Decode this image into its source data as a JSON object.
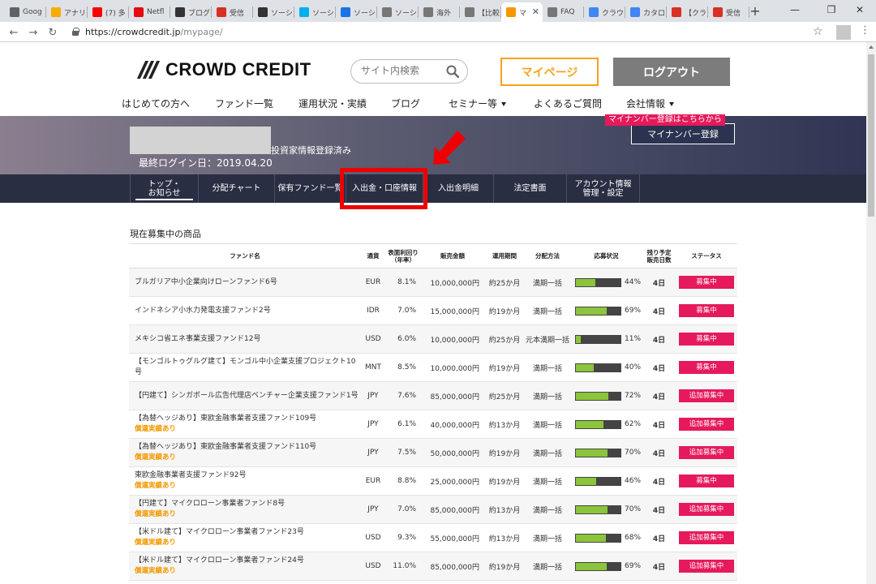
{
  "browser": {
    "tabs": [
      {
        "title": "Goog",
        "icon": "help-circle-icon",
        "color": "#5f6368"
      },
      {
        "title": "アナリ",
        "icon": "analytics-icon",
        "color": "#f9ab00"
      },
      {
        "title": "(7) 多",
        "icon": "youtube-icon",
        "color": "#ff0000"
      },
      {
        "title": "Netfl",
        "icon": "netflix-icon",
        "color": "#e50914"
      },
      {
        "title": "ブログ",
        "icon": "info-circle-icon",
        "color": "#333333"
      },
      {
        "title": "受信",
        "icon": "gmail-icon",
        "color": "#d93025"
      },
      {
        "title": "ソーシ",
        "icon": "wikipedia-icon",
        "color": "#333333"
      },
      {
        "title": "ソーシ",
        "icon": "skype-icon",
        "color": "#00aff0"
      },
      {
        "title": "ソーシ",
        "icon": "flag-icon",
        "color": "#1a73e8"
      },
      {
        "title": "ソーシ",
        "icon": "document-icon",
        "color": "#777777"
      },
      {
        "title": "海外",
        "icon": "document-icon",
        "color": "#777777"
      },
      {
        "title": "【比較",
        "icon": "document-icon",
        "color": "#777777"
      },
      {
        "title": "マ",
        "icon": "crowdcredit-icon",
        "color": "#f39800"
      },
      {
        "title": "FAQ",
        "icon": "document-icon",
        "color": "#777777"
      },
      {
        "title": "クラウ",
        "icon": "google-icon",
        "color": "#4285f4"
      },
      {
        "title": "カタロ",
        "icon": "google-icon",
        "color": "#4285f4"
      },
      {
        "title": "【クラ",
        "icon": "gmail-icon",
        "color": "#d93025"
      },
      {
        "title": "受信",
        "icon": "gmail-icon",
        "color": "#d93025"
      }
    ],
    "new_tab": "+",
    "minimize": "—",
    "maximize": "❐",
    "close": "✕",
    "url_host": "https://crowdcredit.jp",
    "url_path": "/mypage/",
    "back": "←",
    "forward": "→",
    "reload": "↻",
    "bookmark": "☆",
    "menu": "⋮"
  },
  "header": {
    "logo_text": "CROWD CREDIT",
    "search_placeholder": "サイト内検索",
    "mypage_label": "マイページ",
    "logout_label": "ログアウト",
    "nav": [
      {
        "label": "はじめての方へ",
        "dropdown": false
      },
      {
        "label": "ファンド一覧",
        "dropdown": false
      },
      {
        "label": "運用状況・実績",
        "dropdown": false
      },
      {
        "label": "ブログ",
        "dropdown": false
      },
      {
        "label": "セミナー等",
        "dropdown": true
      },
      {
        "label": "よくあるご質問",
        "dropdown": false
      },
      {
        "label": "会社情報",
        "dropdown": true
      }
    ]
  },
  "banner": {
    "investor_status": "投資家情報登録済み",
    "last_login": "最終ログイン日：2019.04.20",
    "mynumber_tip": "マイナンバー登録はこちらから",
    "mynumber_button": "マイナンバー登録"
  },
  "subnav": [
    {
      "label": "トップ・\nお知らせ",
      "current": true
    },
    {
      "label": "分配チャート",
      "current": false
    },
    {
      "label": "保有ファンド一覧",
      "current": false
    },
    {
      "label": "入出金・口座情報",
      "current": false
    },
    {
      "label": "入出金明細",
      "current": false
    },
    {
      "label": "法定書面",
      "current": false
    },
    {
      "label": "アカウント情報\n管理・設定",
      "current": false
    }
  ],
  "section_title": "現在募集中の商品",
  "table": {
    "headers": [
      "ファンド名",
      "通貨",
      "表面利回り\n（年率）",
      "販売金額",
      "運用期間",
      "分配方法",
      "応募状況",
      "残り予定\n販売日数",
      "ステータス"
    ],
    "rows": [
      {
        "name": "ブルガリア中小企業向けローンファンド6号",
        "note": "",
        "currency": "EUR",
        "rate": "8.1%",
        "amount": "10,000,000円",
        "period": "約25か月",
        "method": "満期一括",
        "progress": 44,
        "progress_label": "44%",
        "days": "4日",
        "status": "募集中"
      },
      {
        "name": "インドネシア小水力発電支援ファンド2号",
        "note": "",
        "currency": "IDR",
        "rate": "7.0%",
        "amount": "15,000,000円",
        "period": "約19か月",
        "method": "満期一括",
        "progress": 69,
        "progress_label": "69%",
        "days": "4日",
        "status": "募集中"
      },
      {
        "name": "メキシコ省エネ事業支援ファンド12号",
        "note": "",
        "currency": "USD",
        "rate": "6.0%",
        "amount": "10,000,000円",
        "period": "約25か月",
        "method": "元本満期一括",
        "progress": 11,
        "progress_label": "11%",
        "days": "4日",
        "status": "募集中"
      },
      {
        "name": "【モンゴルトゥグルグ建て】モンゴル中小企業支援プロジェクト10号",
        "note": "",
        "currency": "MNT",
        "rate": "8.5%",
        "amount": "10,000,000円",
        "period": "約19か月",
        "method": "満期一括",
        "progress": 40,
        "progress_label": "40%",
        "days": "4日",
        "status": "募集中"
      },
      {
        "name": "【円建て】シンガポール広告代理店ベンチャー企業支援ファンド1号",
        "note": "",
        "currency": "JPY",
        "rate": "7.6%",
        "amount": "85,000,000円",
        "period": "約25か月",
        "method": "満期一括",
        "progress": 72,
        "progress_label": "72%",
        "days": "4日",
        "status": "追加募集中"
      },
      {
        "name": "【為替ヘッジあり】東欧金融事業者支援ファンド109号",
        "note": "償還実績あり",
        "currency": "JPY",
        "rate": "6.1%",
        "amount": "40,000,000円",
        "period": "約13か月",
        "method": "満期一括",
        "progress": 62,
        "progress_label": "62%",
        "days": "4日",
        "status": "追加募集中"
      },
      {
        "name": "【為替ヘッジあり】東欧金融事業者支援ファンド110号",
        "note": "償還実績あり",
        "currency": "JPY",
        "rate": "7.5%",
        "amount": "50,000,000円",
        "period": "約19か月",
        "method": "満期一括",
        "progress": 70,
        "progress_label": "70%",
        "days": "4日",
        "status": "追加募集中"
      },
      {
        "name": "東欧金融事業者支援ファンド92号",
        "note": "償還実績あり",
        "currency": "EUR",
        "rate": "8.8%",
        "amount": "25,000,000円",
        "period": "約19か月",
        "method": "満期一括",
        "progress": 46,
        "progress_label": "46%",
        "days": "4日",
        "status": "募集中"
      },
      {
        "name": "【円建て】マイクロローン事業者ファンド8号",
        "note": "償還実績あり",
        "currency": "JPY",
        "rate": "7.0%",
        "amount": "85,000,000円",
        "period": "約13か月",
        "method": "満期一括",
        "progress": 70,
        "progress_label": "70%",
        "days": "4日",
        "status": "追加募集中"
      },
      {
        "name": "【米ドル建て】マイクロローン事業者ファンド23号",
        "note": "償還実績あり",
        "currency": "USD",
        "rate": "9.3%",
        "amount": "55,000,000円",
        "period": "約13か月",
        "method": "満期一括",
        "progress": 68,
        "progress_label": "68%",
        "days": "4日",
        "status": "追加募集中"
      },
      {
        "name": "【米ドル建て】マイクロローン事業者ファンド24号",
        "note": "償還実績あり",
        "currency": "USD",
        "rate": "11.0%",
        "amount": "85,000,000円",
        "period": "約19か月",
        "method": "満期一括",
        "progress": 69,
        "progress_label": "69%",
        "days": "4日",
        "status": "追加募集中"
      }
    ]
  },
  "colors": {
    "accent_orange": "#f7a21b",
    "status_pink": "#e6195c",
    "progress_green": "#8cc43c",
    "highlight_red": "#ee0000"
  }
}
